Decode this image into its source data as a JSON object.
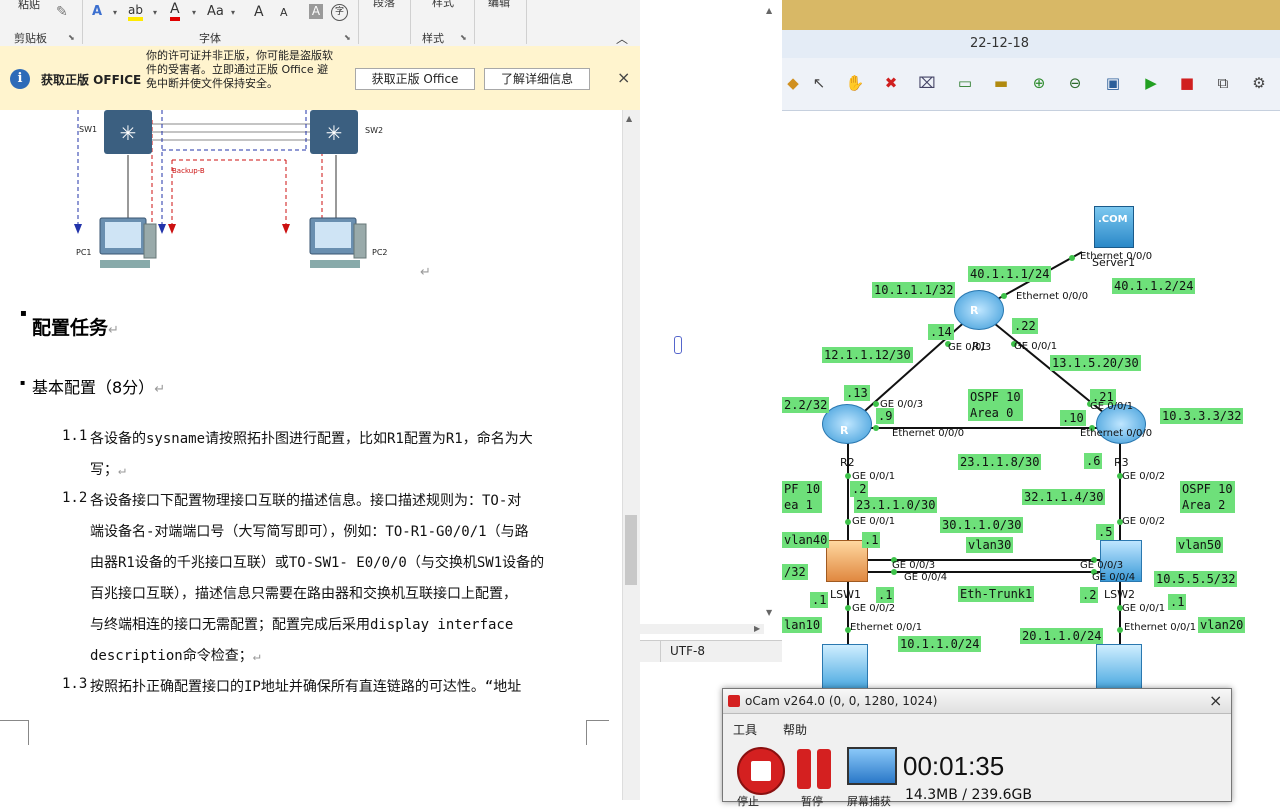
{
  "word": {
    "ribbon": {
      "paste": "粘贴",
      "clipboard_group": "剪贴板",
      "font_group": "字体",
      "paragraph_group": "段落",
      "styles_btn": "样式",
      "styles_group": "样式",
      "editing_group": "编辑",
      "text_effect_glyph": "A",
      "highlight_glyph": "ab",
      "font_color_glyph": "A",
      "change_case_glyph": "Aa",
      "grow_font_glyph": "A",
      "shrink_font_glyph": "A",
      "clear_format_glyph": "A",
      "phonetic_glyph": "字"
    },
    "infobar": {
      "title": "获取正版 OFFICE",
      "message": "你的许可证并非正版，你可能是盗版软件的受害者。立即通过正版 Office 避免中断并使文件保持安全。",
      "get_button": "获取正版 Office",
      "learn_button": "了解详细信息",
      "close": "×"
    },
    "figure": {
      "sw1": "SW1",
      "sw2": "SW2",
      "backup": "Backup-B",
      "pc1": "PC1",
      "pc2": "PC2"
    },
    "doc": {
      "heading1": "配置任务",
      "heading2": "基本配置（8分）",
      "items": [
        {
          "num": "1.1",
          "lines": [
            "各设备的sysname请按照拓扑图进行配置，比如R1配置为R1，命名为大",
            "写；"
          ]
        },
        {
          "num": "1.2",
          "lines": [
            "各设备接口下配置物理接口互联的描述信息。接口描述规则为：TO-对",
            "端设备名-对端端口号（大写简写即可），例如：TO-R1-G0/0/1（与路",
            "由器R1设备的千兆接口互联）或TO-SW1- E0/0/0（与交换机SW1设备的",
            "百兆接口互联），描述信息只需要在路由器和交换机互联接口上配置，",
            "与终端相连的接口无需配置；配置完成后采用display interface",
            "description命令检查；"
          ]
        },
        {
          "num": "1.3",
          "lines": [
            "按照拓扑正确配置接口的IP地址并确保所有直连链路的可达性。“地址"
          ]
        }
      ]
    }
  },
  "notepad": {
    "encoding": "UTF-8"
  },
  "ensp": {
    "date": "22-12-18",
    "devices": {
      "r1": "R1",
      "r2": "R2",
      "r3": "R3",
      "lsw1": "LSW1",
      "lsw2": "LSW2",
      "server": "Server1",
      "server_badge": ".COM"
    },
    "labels": [
      "10.1.1.1/32",
      "40.1.1.1/24",
      "40.1.1.2/24",
      ".14",
      ".22",
      "12.1.1.12/30",
      "13.1.5.20/30",
      ".13",
      "2.2/32",
      ".9",
      "OSPF 10\nArea 0",
      ".21",
      ".10",
      "10.3.3.3/32",
      "23.1.1.8/30",
      ".6",
      "PF 10\nea 1",
      ".2",
      "23.1.1.0/30",
      "32.1.1.4/30",
      "OSPF 10\nArea 2",
      "30.1.1.0/30",
      ".1",
      "vlan40",
      "vlan30",
      ".5",
      "vlan50",
      "/32",
      "10.5.5.5/32",
      "Eth-Trunk1",
      ".1",
      ".1",
      ".2",
      ".1",
      "lan10",
      "vlan20",
      "10.1.1.0/24",
      "20.1.1.0/24"
    ],
    "ports": {
      "srv_eth": "Ethernet 0/0/0",
      "r1_eth": "Ethernet 0/0/0",
      "r1_g3": "GE 0/0/3",
      "r1_g1": "GE 0/0/1",
      "r2_g3": "GE 0/0/3",
      "r2_eth": "Ethernet 0/0/0",
      "r3_g1": "GE 0/0/1",
      "r3_eth": "Ethernet 0/0/0",
      "r2_g01": "GE 0/0/1",
      "r3_g02": "GE 0/0/2",
      "lsw1_g1": "GE 0/0/1",
      "lsw2_g2": "GE 0/0/2",
      "lsw1_g3": "GE 0/0/3",
      "lsw1_g4": "GE 0/0/4",
      "lsw2_g3": "GE 0/0/3",
      "lsw2_g4": "GE 0/0/4",
      "lsw1_g2": "GE 0/0/2",
      "lsw2_g1": "GE 0/0/1",
      "pc1_eth": "Ethernet 0/0/1",
      "pc2_eth": "Ethernet 0/0/1"
    }
  },
  "ocam": {
    "title": "oCam v264.0 (0, 0, 1280, 1024)",
    "menu_tools": "工具",
    "menu_help": "帮助",
    "timer": "00:01:35",
    "size": "14.3MB / 239.6GB",
    "btn_stop": "停止",
    "btn_pause": "暂停",
    "btn_screen": "屏幕捕获",
    "close": "×",
    "colors": {
      "record": "#d42020",
      "pause": "#d42020"
    }
  },
  "colors": {
    "label_green": "#6ee07a",
    "infobar": "#fff4ce",
    "word_accent": "#2b579a"
  }
}
